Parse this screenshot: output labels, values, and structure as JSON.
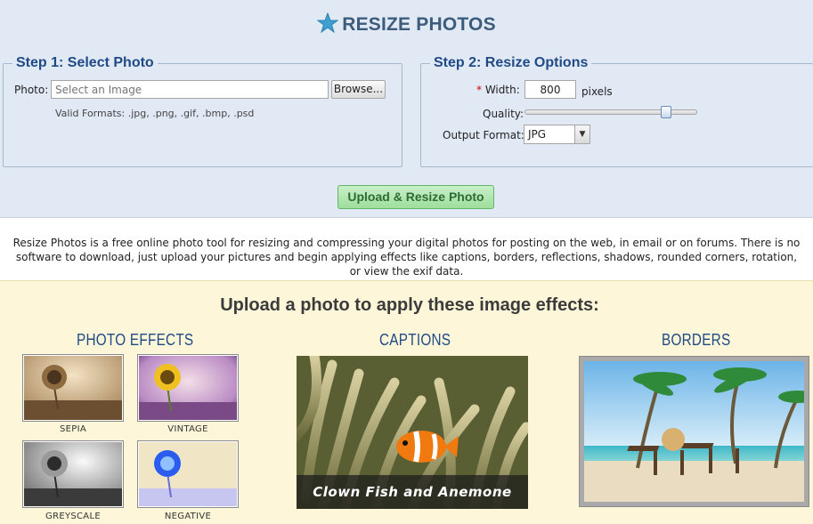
{
  "header": {
    "title": "RESIZE PHOTOS",
    "icon": "star-icon"
  },
  "step1": {
    "legend": "Step 1: Select Photo",
    "photo_label": "Photo:",
    "photo_placeholder": "Select an Image",
    "browse_label": "Browse...",
    "formats": "Valid Formats: .jpg, .png, .gif, .bmp, .psd"
  },
  "step2": {
    "legend": "Step 2: Resize Options",
    "required_mark": "*",
    "width_label": "Width:",
    "width_value": "800",
    "width_unit": "pixels",
    "quality_label": "Quality:",
    "quality_level": 0.85,
    "format_label": "Output Format:",
    "format_value": "JPG"
  },
  "upload_button": "Upload & Resize Photo",
  "description": "Resize Photos is a free online photo tool for resizing and compressing your digital photos for posting on the web, in email or on forums. There is no software to download, just upload your pictures and begin applying effects like captions, borders, reflections, shadows, rounded corners, rotation, or view the exif data.",
  "effects": {
    "title": "Upload a photo to apply these image effects:",
    "photo_effects": {
      "heading": "PHOTO EFFECTS",
      "items": [
        "SEPIA",
        "VINTAGE",
        "GREYSCALE",
        "NEGATIVE"
      ]
    },
    "captions": {
      "heading": "CAPTIONS",
      "caption_text": "Clown Fish and Anemone"
    },
    "borders": {
      "heading": "BORDERS"
    }
  },
  "colors": {
    "accent": "#1f4a86",
    "band": "#e1e9f5",
    "effects_bg": "#fef6d9",
    "upload_green": "#9ede9c"
  }
}
